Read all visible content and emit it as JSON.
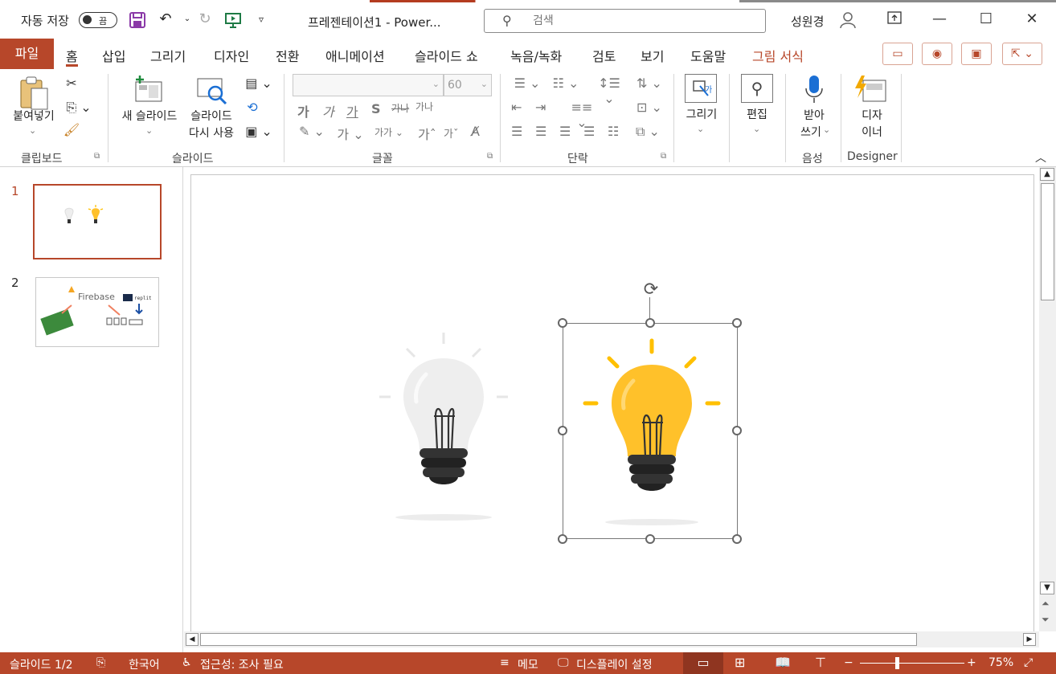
{
  "titlebar": {
    "autosave_label": "자동 저장",
    "autosave_state": "끔",
    "doc_title": "프레젠테이션1  -  Power...",
    "search_placeholder": "검색",
    "user_name": "성원경"
  },
  "tabs": {
    "file": "파일",
    "items": [
      "홈",
      "삽입",
      "그리기",
      "디자인",
      "전환",
      "애니메이션",
      "슬라이드 쇼",
      "녹음/녹화",
      "검토",
      "보기",
      "도움말"
    ],
    "context": "그림 서식"
  },
  "ribbon": {
    "clipboard": {
      "paste": "붙여넣기",
      "group": "클립보드"
    },
    "slides": {
      "new_slide": "새 슬라이드",
      "reuse_1": "슬라이드",
      "reuse_2": "다시 사용",
      "group": "슬라이드"
    },
    "font": {
      "size": "60",
      "group": "글꼴",
      "bold": "가",
      "italic": "가",
      "underline": "가",
      "shadow": "S",
      "strike": "가나",
      "spacing": "가나",
      "grow": "가",
      "shrink": "가",
      "case": "가가",
      "highlight": "가"
    },
    "paragraph": {
      "group": "단락"
    },
    "draw": {
      "label": "그리기"
    },
    "edit": {
      "label": "편집"
    },
    "voice": {
      "label_1": "받아",
      "label_2": "쓰기",
      "group": "음성"
    },
    "designer": {
      "label_1": "디자",
      "label_2": "이너",
      "group": "Designer"
    }
  },
  "thumbnails": {
    "slide1_num": "1",
    "slide2_num": "2",
    "slide2_firebase": "Firebase",
    "slide2_replit": "replit"
  },
  "status": {
    "slide_info": "슬라이드 1/2",
    "language": "한국어",
    "accessibility": "접근성: 조사 필요",
    "notes": "메모",
    "display": "디스플레이 설정",
    "zoom": "75%"
  },
  "colors": {
    "accent": "#b7472a",
    "bulb_on": "#ffc12a",
    "bulb_off": "#eeeeee",
    "ray_on": "#ffc000",
    "base": "#333333"
  }
}
